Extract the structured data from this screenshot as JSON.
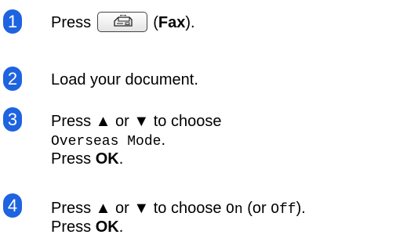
{
  "colors": {
    "badge": "#1e63e0",
    "text": "#000000"
  },
  "steps": [
    {
      "number": "1",
      "press": "Press",
      "icon": "fax-icon",
      "paren_open": "(",
      "key_name": "Fax",
      "paren_close": ")."
    },
    {
      "number": "2",
      "text": "Load your document."
    },
    {
      "number": "3",
      "line1": "Press ▲ or ▼ to choose",
      "menu_option": "Overseas Mode",
      "period": ".",
      "press": "Press",
      "ok": "OK",
      "end": "."
    },
    {
      "number": "4",
      "line1_pre": "Press ▲ or ▼ to choose",
      "on": "On",
      "mid": "(or",
      "off": "Off",
      "close": ").",
      "press": "Press",
      "ok": "OK",
      "end": "."
    }
  ]
}
